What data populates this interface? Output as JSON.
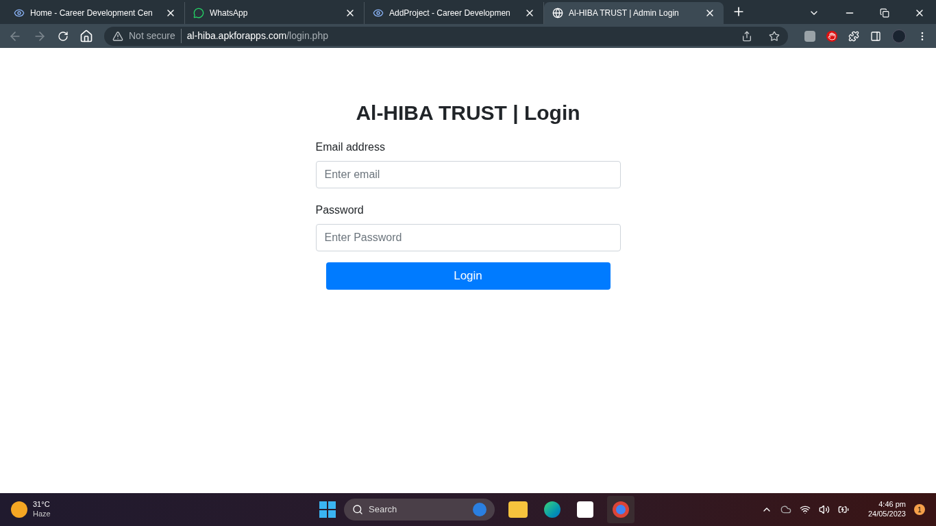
{
  "browser": {
    "tabs": [
      {
        "title": "Home - Career Development Cen",
        "kind": "eye",
        "selected": false
      },
      {
        "title": "WhatsApp",
        "kind": "chat",
        "selected": false
      },
      {
        "title": "AddProject - Career Developmen",
        "kind": "eye",
        "selected": false
      },
      {
        "title": "Al-HIBA TRUST | Admin Login",
        "kind": "globe",
        "selected": true
      }
    ],
    "security": "Not secure",
    "url_host": "al-hiba.apkforapps.com",
    "url_path": "/login.php"
  },
  "page": {
    "heading": "Al-HIBA TRUST | Login",
    "email_label": "Email address",
    "email_placeholder": "Enter email",
    "password_label": "Password",
    "password_placeholder": "Enter Password",
    "submit": "Login"
  },
  "taskbar": {
    "temperature": "31°C",
    "weather": "Haze",
    "search_placeholder": "Search",
    "time": "4:46 pm",
    "date": "24/05/2023",
    "notifications": "1"
  }
}
